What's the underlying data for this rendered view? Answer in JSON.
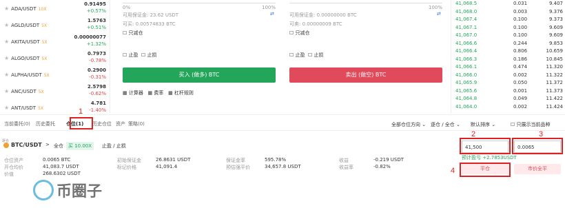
{
  "coins": [
    {
      "pair": "ADA/USDT",
      "lev": "10X",
      "price": "0.91495",
      "chg": "+0.57%",
      "up": true
    },
    {
      "pair": "AGLD/USDT",
      "lev": "5X",
      "price": "1.5763",
      "chg": "+0.51%",
      "up": true
    },
    {
      "pair": "AKITA/USDT",
      "lev": "5X",
      "price": "0.00000077",
      "chg": "+1.32%",
      "up": true
    },
    {
      "pair": "ALGO/USDT",
      "lev": "5X",
      "price": "0.7973",
      "chg": "-0.78%",
      "up": false
    },
    {
      "pair": "ALPHA/USDT",
      "lev": "5X",
      "price": "0.2900",
      "chg": "-0.31%",
      "up": false
    },
    {
      "pair": "ANC/USDT",
      "lev": "5X",
      "price": "2.5798",
      "chg": "-0.62%",
      "up": false
    },
    {
      "pair": "ANT/USDT",
      "lev": "5X",
      "price": "4.781",
      "chg": "-1.40%",
      "up": false
    }
  ],
  "buyPanel": {
    "pct0": "0%",
    "pct100": "100%",
    "available": "可用保证金: 23.62 USDT",
    "openable": "可买: 0.00574833 BTC",
    "reduce": "只减仓",
    "tp": "止盈",
    "sl": "止损",
    "btn": "买入 (做多) BTC",
    "calc": "计算器",
    "fee": "费率",
    "rule": "杠杆规则"
  },
  "sellPanel": {
    "pct100": "100%",
    "available": "可用保证金: 0.00000000 BTC",
    "openable": "可卖: 0.00000009 BTC",
    "reduce": "只减仓",
    "tp": "止盈",
    "sl": "止损",
    "btn": "卖出 (做空) BTC"
  },
  "book": [
    {
      "p": "41,068.5",
      "q": "0.031",
      "t": "9.407"
    },
    {
      "p": "41,068.0",
      "q": "0.003",
      "t": "9.376"
    },
    {
      "p": "41,067.4",
      "q": "0.100",
      "t": "9.373"
    },
    {
      "p": "41,067.1",
      "q": "0.100",
      "t": "9.609"
    },
    {
      "p": "41,067.0",
      "q": "0.100",
      "t": "9.609"
    },
    {
      "p": "41,066.6",
      "q": "0.244",
      "t": "9.853"
    },
    {
      "p": "41,066.4",
      "q": "0.806",
      "t": "10.659"
    },
    {
      "p": "41,066.3",
      "q": "0.186",
      "t": "10.845"
    },
    {
      "p": "41,066.1",
      "q": "0.474",
      "t": "11.320"
    },
    {
      "p": "41,066.0",
      "q": "0.002",
      "t": "11.322"
    },
    {
      "p": "41,065.9",
      "q": "0.050",
      "t": "11.372"
    },
    {
      "p": "41,065.6",
      "q": "0.001",
      "t": "11.373"
    },
    {
      "p": "41,064.8",
      "q": "0.049",
      "t": "11.422"
    },
    {
      "p": "41,064.0",
      "q": "0.002",
      "t": "11.424"
    }
  ],
  "tabs": [
    "当前委托(0)",
    "历史委托",
    "仓位(1)",
    "历史仓位",
    "资产",
    "策略(0)"
  ],
  "filters": {
    "all": "全部仓位方向",
    "mode": "逐仓 / 全仓",
    "sort": "默认排序",
    "only": "只展示当前品种"
  },
  "pos": {
    "badge": "逐仓",
    "pair": "BTC/USDT",
    "arrow": ">",
    "cross": "全仓",
    "side": "买 10.00X",
    "tpsl": "止盈 / 止损"
  },
  "stats": [
    {
      "l": "仓位资产",
      "v": "0.0065 BTC"
    },
    {
      "l": "初始保证金",
      "v": "26.8631 USDT"
    },
    {
      "l": "保证金率",
      "v": "595.78%"
    },
    {
      "l": "收益",
      "v": "-0.219 USDT"
    },
    {
      "l": "开仓均价",
      "v": "41,083.7 USDT"
    },
    {
      "l": "标记价格",
      "v": "41,091.4"
    },
    {
      "l": "预估强平价",
      "v": "34,657.8 USDT"
    },
    {
      "l": "收益率",
      "v": "-0.82%"
    },
    {
      "l": "价值",
      "v": "268.6302 USDT"
    }
  ],
  "closeForm": {
    "price": "41,500",
    "qty": "0.0065",
    "profit": "预计盈亏 +2.7853USDT",
    "close": "平仓",
    "market": "市价全平"
  },
  "marks": {
    "m1": "1",
    "m2": "2",
    "m3": "3",
    "m4": "4"
  },
  "logo": "币圈子",
  "colors": {
    "green": "#23a55a",
    "red": "#e04a5a",
    "orange": "#f0a030"
  }
}
